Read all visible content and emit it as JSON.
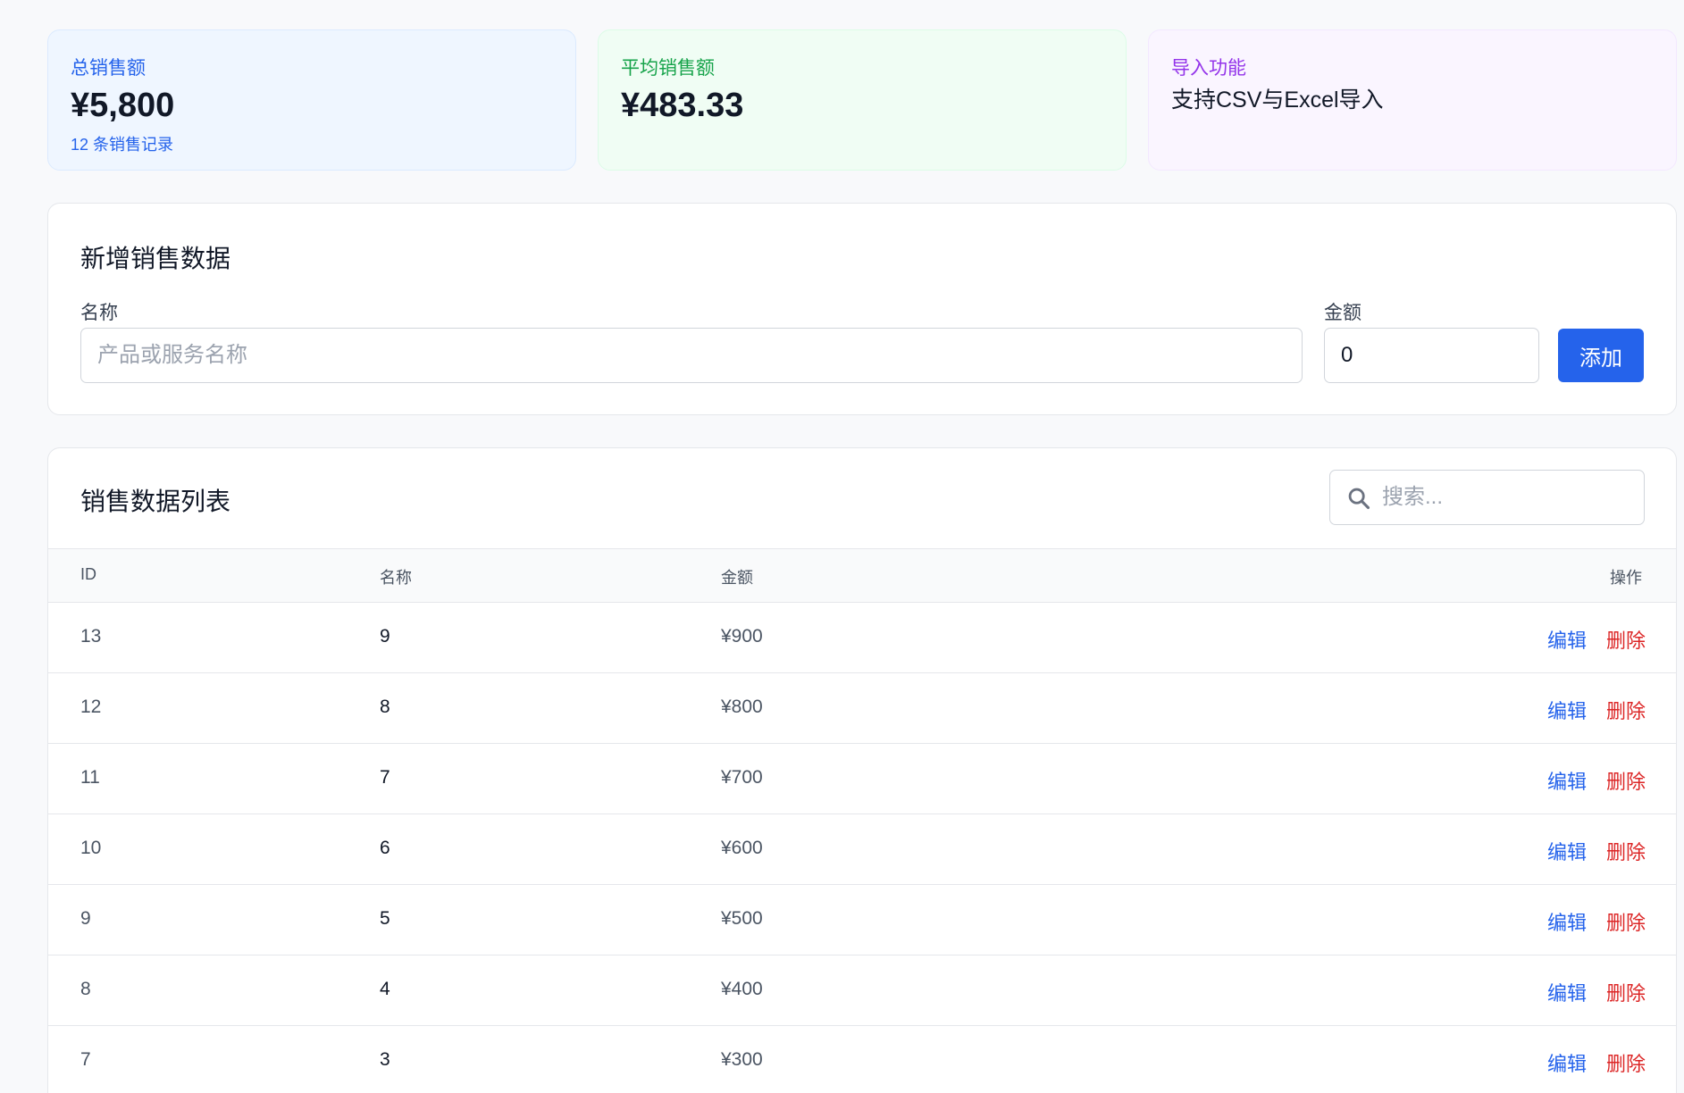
{
  "colors": {
    "primary": "#2563eb",
    "danger": "#dc2626",
    "total_card_accent": "#2563eb",
    "avg_card_accent": "#16a34a",
    "import_card_accent": "#9333ea"
  },
  "stats": {
    "total": {
      "label": "总销售额",
      "value": "¥5,800",
      "sub": "12 条销售记录"
    },
    "average": {
      "label": "平均销售额",
      "value": "¥483.33"
    },
    "import": {
      "label": "导入功能",
      "text": "支持CSV与Excel导入"
    }
  },
  "add_form": {
    "title": "新增销售数据",
    "name_label": "名称",
    "name_placeholder": "产品或服务名称",
    "name_value": "",
    "amount_label": "金额",
    "amount_value": "0",
    "submit_label": "添加"
  },
  "list": {
    "title": "销售数据列表",
    "search_placeholder": "搜索...",
    "search_icon": "search-icon",
    "columns": {
      "id": "ID",
      "name": "名称",
      "amount": "金额",
      "actions": "操作"
    },
    "edit_label": "编辑",
    "delete_label": "删除",
    "rows": [
      {
        "id": "13",
        "name": "9",
        "amount": "¥900"
      },
      {
        "id": "12",
        "name": "8",
        "amount": "¥800"
      },
      {
        "id": "11",
        "name": "7",
        "amount": "¥700"
      },
      {
        "id": "10",
        "name": "6",
        "amount": "¥600"
      },
      {
        "id": "9",
        "name": "5",
        "amount": "¥500"
      },
      {
        "id": "8",
        "name": "4",
        "amount": "¥400"
      },
      {
        "id": "7",
        "name": "3",
        "amount": "¥300"
      }
    ]
  }
}
